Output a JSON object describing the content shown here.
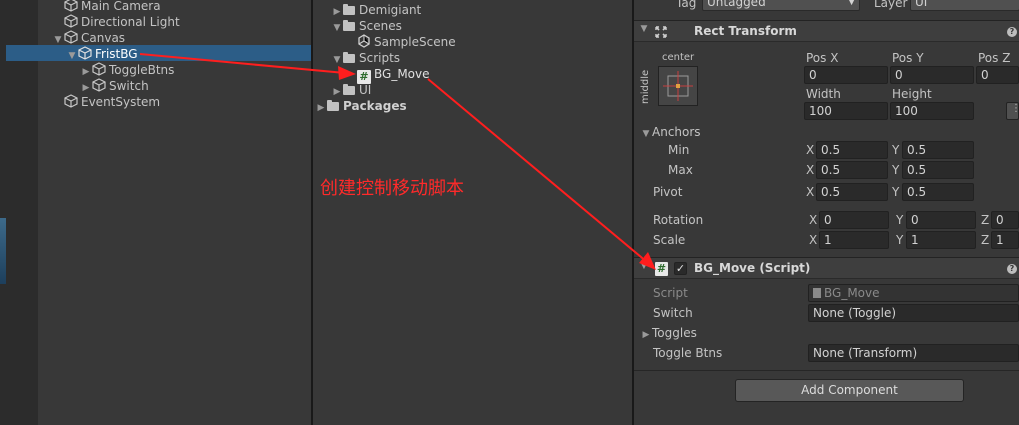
{
  "hierarchy": {
    "items": [
      {
        "label": "Main Camera"
      },
      {
        "label": "Directional Light"
      },
      {
        "label": "Canvas"
      },
      {
        "label": "FristBG"
      },
      {
        "label": "ToggleBtns"
      },
      {
        "label": "Switch"
      },
      {
        "label": "EventSystem"
      }
    ]
  },
  "project": {
    "items": [
      {
        "label": "Demigiant"
      },
      {
        "label": "Scenes"
      },
      {
        "label": "SampleScene"
      },
      {
        "label": "Scripts"
      },
      {
        "label": "BG_Move"
      },
      {
        "label": "UI"
      },
      {
        "label": "Packages"
      }
    ]
  },
  "annotation": {
    "text": "创建控制移动脚本",
    "color": "#ff2a2a"
  },
  "inspector": {
    "tag_label": "Tag",
    "tag_value": "Untagged",
    "layer_label": "Layer",
    "layer_value": "UI",
    "rect_transform": {
      "title": "Rect Transform",
      "anchor_h": "center",
      "anchor_v": "middle",
      "pos_x_label": "Pos X",
      "pos_x": "0",
      "pos_y_label": "Pos Y",
      "pos_y": "0",
      "pos_z_label": "Pos Z",
      "pos_z": "0",
      "width_label": "Width",
      "width": "100",
      "height_label": "Height",
      "height": "100",
      "anchors_label": "Anchors",
      "min_label": "Min",
      "min_x": "0.5",
      "min_y": "0.5",
      "max_label": "Max",
      "max_x": "0.5",
      "max_y": "0.5",
      "pivot_label": "Pivot",
      "pivot_x": "0.5",
      "pivot_y": "0.5",
      "rotation_label": "Rotation",
      "rot_x": "0",
      "rot_y": "0",
      "rot_z": "0",
      "scale_label": "Scale",
      "scale_x": "1",
      "scale_y": "1",
      "scale_z": "1",
      "x": "X",
      "y": "Y",
      "z": "Z"
    },
    "script_component": {
      "title": "BG_Move (Script)",
      "script_label": "Script",
      "script_value": "BG_Move",
      "switch_label": "Switch",
      "switch_value": "None (Toggle)",
      "toggles_label": "Toggles",
      "toggle_btns_label": "Toggle Btns",
      "toggle_btns_value": "None (Transform)"
    },
    "add_component": "Add Component"
  }
}
